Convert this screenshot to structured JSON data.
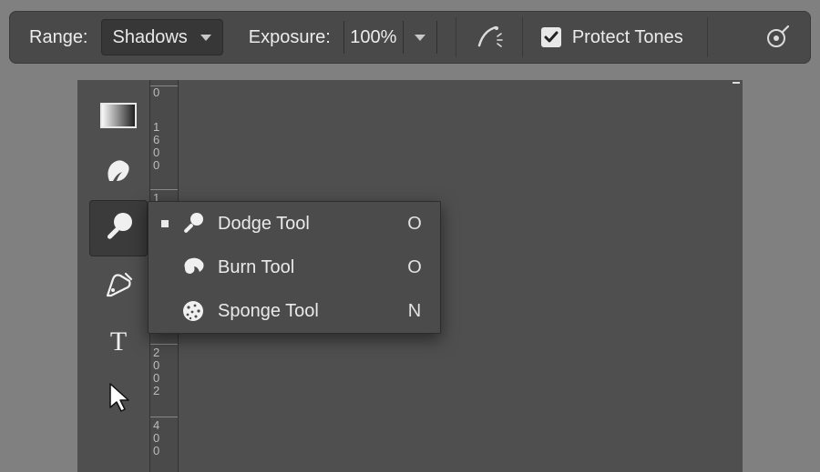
{
  "options_bar": {
    "range_label": "Range:",
    "range_value": "Shadows",
    "exposure_label": "Exposure:",
    "exposure_value": "100%",
    "protect_tones_label": "Protect Tones",
    "protect_tones_checked": true
  },
  "toolbar": {
    "tools": [
      {
        "name": "gradient-tool"
      },
      {
        "name": "smudge-tool"
      },
      {
        "name": "dodge-tool",
        "selected": true
      },
      {
        "name": "pen-tool"
      },
      {
        "name": "type-tool"
      },
      {
        "name": "path-selection-tool"
      }
    ]
  },
  "ruler": {
    "ticks": [
      "0",
      "1",
      "6",
      "0",
      "0",
      "1",
      "2",
      "0",
      "0",
      "2",
      "4",
      "0",
      "0"
    ]
  },
  "flyout": {
    "items": [
      {
        "name": "Dodge Tool",
        "shortcut": "O",
        "selected": true,
        "icon": "dodge-icon"
      },
      {
        "name": "Burn Tool",
        "shortcut": "O",
        "selected": false,
        "icon": "burn-icon"
      },
      {
        "name": "Sponge Tool",
        "shortcut": "N",
        "selected": false,
        "icon": "sponge-icon"
      }
    ]
  }
}
